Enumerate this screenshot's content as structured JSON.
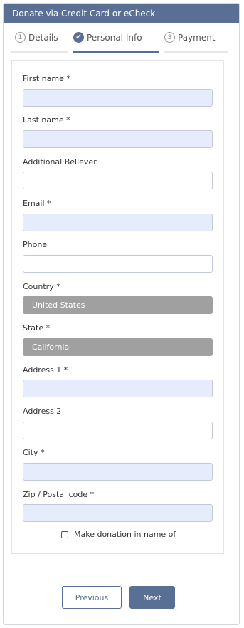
{
  "header": {
    "title": "Donate via Credit Card or eCheck"
  },
  "steps": [
    {
      "number": "1",
      "label": "Details"
    },
    {
      "number": "",
      "label": "Personal Info"
    },
    {
      "number": "3",
      "label": "Payment"
    }
  ],
  "form": {
    "first_name_label": "First name *",
    "last_name_label": "Last name *",
    "additional_believer_label": "Additional Believer",
    "email_label": "Email *",
    "phone_label": "Phone",
    "country_label": "Country *",
    "country_value": "United States",
    "state_label": "State *",
    "state_value": "California",
    "address1_label": "Address 1 *",
    "address2_label": "Address 2",
    "city_label": "City *",
    "zip_label": "Zip / Postal code *",
    "name_of_label": "Make donation in name of"
  },
  "buttons": {
    "previous": "Previous",
    "next": "Next"
  },
  "colors": {
    "accent": "#5a6f94",
    "required_field": "#e6ecfb",
    "select_bg": "#a0a0a0"
  }
}
